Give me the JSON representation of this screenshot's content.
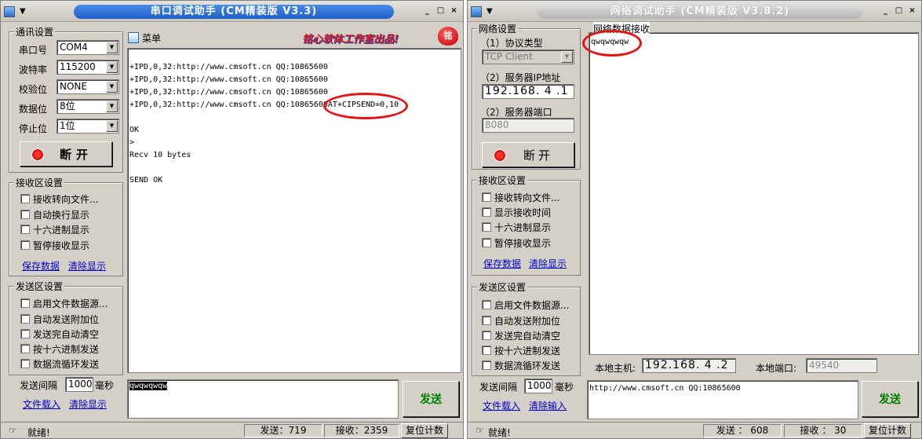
{
  "serial": {
    "title": "串口调试助手 (CM精装版 V3.3)",
    "comm_group": "通讯设置",
    "port_label": "串口号",
    "port_value": "COM4",
    "baud_label": "波特率",
    "baud_value": "115200",
    "parity_label": "校验位",
    "parity_value": "NONE",
    "data_label": "数据位",
    "data_value": "8位",
    "stop_label": "停止位",
    "stop_value": "1位",
    "open_btn": "断开",
    "menu_label": "菜单",
    "banner": "铭心软体工作室出品!",
    "heart_text": "铭",
    "recv_group": "接收区设置",
    "recv_opts": [
      "接收转向文件...",
      "自动换行显示",
      "十六进制显示",
      "暂停接收显示"
    ],
    "save_link": "保存数据",
    "clear_link": "清除显示",
    "send_group": "发送区设置",
    "send_opts": [
      "启用文件数据源...",
      "自动发送附加位",
      "发送完自动清空",
      "按十六进制发送",
      "数据流循环发送"
    ],
    "interval_label": "发送间隔",
    "interval_value": "1000",
    "interval_unit": "毫秒",
    "file_link": "文件载入",
    "clear2_link": "清除显示",
    "recv_lines": [
      "",
      "+IPD,0,32:http://www.cmsoft.cn QQ:10865600",
      "+IPD,0,32:http://www.cmsoft.cn QQ:10865600",
      "+IPD,0,32:http://www.cmsoft.cn QQ:10865600",
      "+IPD,0,32:http://www.cmsoft.cn QQ:10865600AT+CIPSEND=0,10",
      "",
      "OK",
      ">",
      "Recv 10 bytes",
      "",
      "SEND OK"
    ],
    "send_text": "qwqwqwqw",
    "send_btn": "发送",
    "status_ready": "就绪!",
    "tx_count": "发送：719",
    "rx_count": "接收：2359",
    "reset_btn": "复位计数"
  },
  "net": {
    "title": "网络调试助手 (CM精装版 V3.8.2)",
    "net_group": "网络设置",
    "proto_label": "（1）协议类型",
    "proto_value": "TCP Client",
    "ip_label": "（2）服务器IP地址",
    "ip_value": "192.168. 4 .1",
    "port_label": "（2）服务器端口",
    "port_value": "8080",
    "open_btn": "断开",
    "recv_title": "网络数据接收",
    "recv_text": "qwqwqwqw",
    "recv_group": "接收区设置",
    "recv_opts": [
      "接收转向文件...",
      "显示接收时间",
      "十六进制显示",
      "暂停接收显示"
    ],
    "save_link": "保存数据",
    "clear_link": "清除显示",
    "send_group": "发送区设置",
    "send_opts": [
      "启用文件数据源...",
      "自动发送附加位",
      "发送完自动清空",
      "按十六进制发送",
      "数据流循环发送"
    ],
    "interval_label": "发送间隔",
    "interval_value": "1000",
    "interval_unit": "毫秒",
    "file_link": "文件载入",
    "clear2_link": "清除输入",
    "local_host_label": "本地主机:",
    "local_host_value": "192.168. 4 .2",
    "local_port_label": "本地端口:",
    "local_port_value": "49540",
    "send_text": "http://www.cmsoft.cn QQ:10865600",
    "send_btn": "发送",
    "status_ready": "就绪!",
    "tx_count": "发送 ： 608",
    "rx_count": "接收 ： 30",
    "reset_btn": "复位计数"
  },
  "colors": {
    "highlight": "#e21515",
    "send_green": "#008000",
    "link_blue": "#0000cc"
  }
}
